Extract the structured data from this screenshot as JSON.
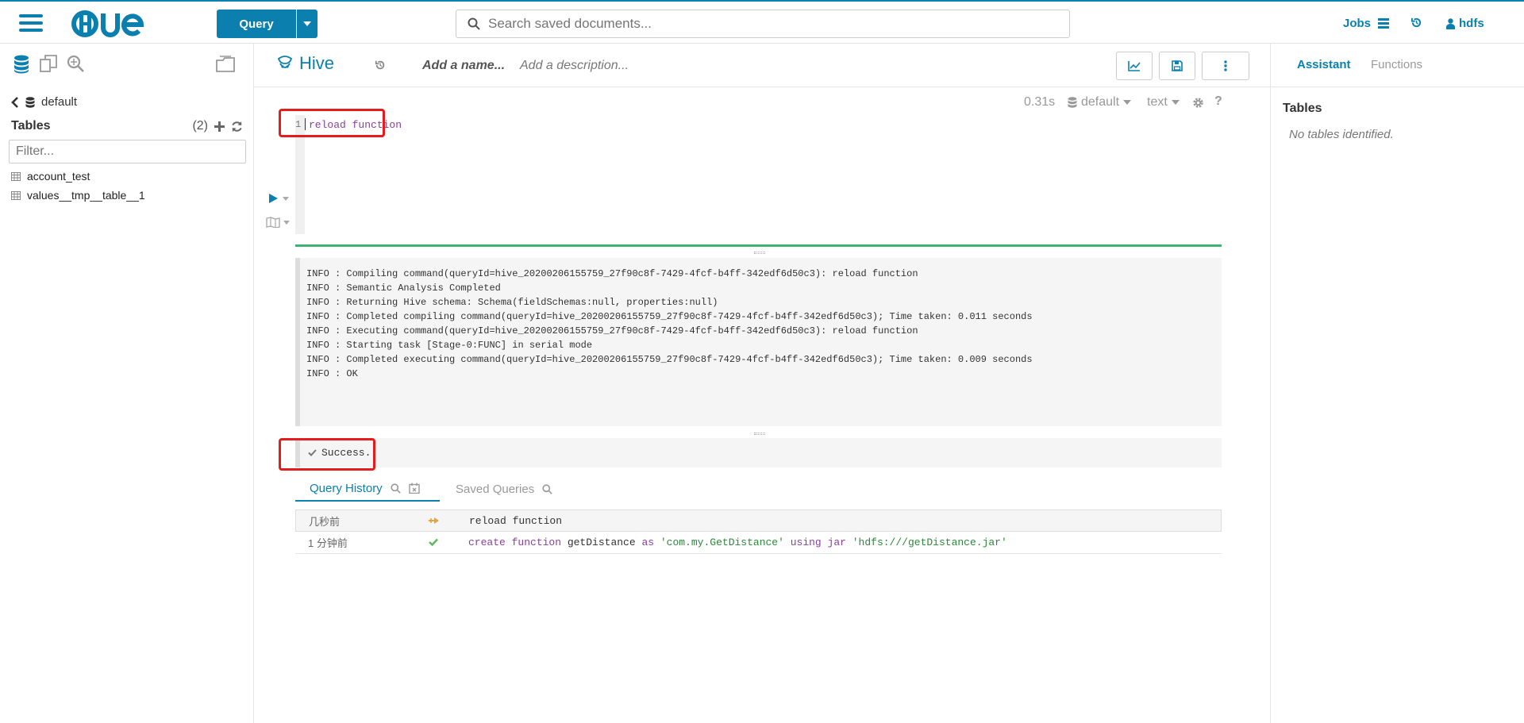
{
  "colors": {
    "accent": "#0b7fad",
    "progress": "#3cb371",
    "highlight": "#e41c1c"
  },
  "topbar": {
    "logo_text": "HUE",
    "query_label": "Query",
    "search_placeholder": "Search saved documents...",
    "jobs_label": "Jobs",
    "user_label": "hdfs"
  },
  "left_panel": {
    "database": "default",
    "tables_title": "Tables",
    "tables_count": "(2)",
    "filter_placeholder": "Filter...",
    "tables": [
      "account_test",
      "values__tmp__table__1"
    ]
  },
  "editor": {
    "engine": "Hive",
    "name_placeholder": "Add a name...",
    "description_placeholder": "Add a description...",
    "exec_time": "0.31s",
    "database": "default",
    "format": "text",
    "line_number": "1",
    "code": "reload function"
  },
  "log_lines": [
    "INFO  : Compiling command(queryId=hive_20200206155759_27f90c8f-7429-4fcf-b4ff-342edf6d50c3): reload function",
    "INFO  : Semantic Analysis Completed",
    "INFO  : Returning Hive schema: Schema(fieldSchemas:null, properties:null)",
    "INFO  : Completed compiling command(queryId=hive_20200206155759_27f90c8f-7429-4fcf-b4ff-342edf6d50c3); Time taken: 0.011 seconds",
    "INFO  : Executing command(queryId=hive_20200206155759_27f90c8f-7429-4fcf-b4ff-342edf6d50c3): reload function",
    "INFO  : Starting task [Stage-0:FUNC] in serial mode",
    "INFO  : Completed executing command(queryId=hive_20200206155759_27f90c8f-7429-4fcf-b4ff-342edf6d50c3); Time taken: 0.009 seconds",
    "INFO  : OK"
  ],
  "result": {
    "message": "Success."
  },
  "history_tabs": {
    "history_label": "Query History",
    "saved_label": "Saved Queries"
  },
  "history": [
    {
      "time": "几秒前",
      "status": "running",
      "query": "reload function"
    },
    {
      "time": "1 分钟前",
      "status": "success",
      "query": "create function getDistance as 'com.my.GetDistance' using jar 'hdfs:///getDistance.jar'"
    }
  ],
  "right_panel": {
    "tab_assistant": "Assistant",
    "tab_functions": "Functions",
    "tables_title": "Tables",
    "no_tables": "No tables identified."
  }
}
